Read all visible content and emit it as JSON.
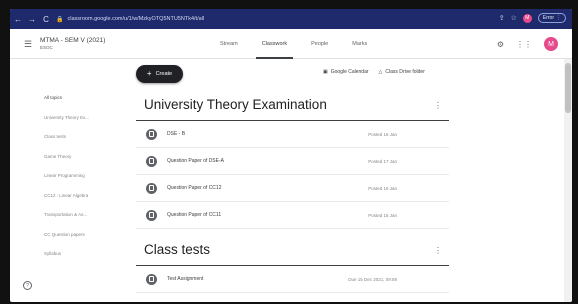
{
  "browser": {
    "url": "classroom.google.com/u/1/w/MzkyOTQ5NTU5NTk4/t/all",
    "error_label": "Error",
    "profile_initial": "M"
  },
  "header": {
    "course_title": "MTMA - SEM V (2021)",
    "course_subtitle": "ESOC",
    "tabs": [
      {
        "label": "Stream"
      },
      {
        "label": "Classwork"
      },
      {
        "label": "People"
      },
      {
        "label": "Marks"
      }
    ],
    "avatar_initial": "M"
  },
  "sidebar": {
    "items": [
      {
        "label": "All topics"
      },
      {
        "label": "University Theory Ex..."
      },
      {
        "label": "Class tests"
      },
      {
        "label": "Game Theory"
      },
      {
        "label": "Linear Programming"
      },
      {
        "label": "CC12 : Linear Algebra"
      },
      {
        "label": "Transportation & As..."
      },
      {
        "label": "CC Question papers"
      },
      {
        "label": "Syllabus"
      }
    ]
  },
  "toolbar": {
    "create_label": "Create",
    "calendar_label": "Google Calendar",
    "drive_label": "Class Drive folder"
  },
  "sections": [
    {
      "title": "University Theory Examination",
      "items": [
        {
          "title": "DSE - B",
          "date": "Posted 16 Jan"
        },
        {
          "title": "Question Paper of DSE-A",
          "date": "Posted 17 Jan"
        },
        {
          "title": "Question Paper of CC12",
          "date": "Posted 16 Jan"
        },
        {
          "title": "Question Paper of CC11",
          "date": "Posted 15 Jan"
        }
      ]
    },
    {
      "title": "Class tests",
      "items": [
        {
          "title": "Test Assignment",
          "date": "Due 15 Dec 2021, 09:59"
        }
      ]
    }
  ],
  "colors": {
    "browser_bar": "#1f2a6d",
    "avatar": "#e64a8a",
    "create_button": "#202124"
  }
}
